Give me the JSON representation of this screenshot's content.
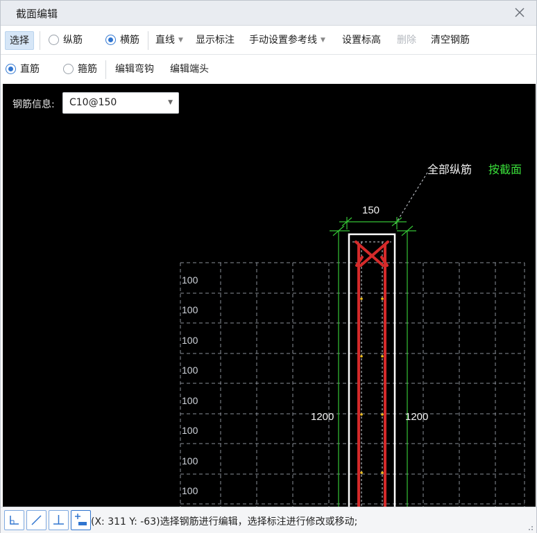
{
  "window": {
    "title": "截面编辑"
  },
  "toolbar1": {
    "select_label": "选择",
    "longitudinal_label": "纵筋",
    "transverse_label": "横筋",
    "line_label": "直线",
    "show_annotation_label": "显示标注",
    "manual_reference_label": "手动设置参考线",
    "set_elevation_label": "设置标高",
    "delete_label": "删除",
    "clear_rebar_label": "清空钢筋"
  },
  "toolbar2": {
    "straight_label": "直筋",
    "stirrup_label": "箍筋",
    "edit_hook_label": "编辑弯钩",
    "edit_end_label": "编辑端头"
  },
  "radios": {
    "rebar_type_selected": "横筋",
    "shape_selected": "直筋"
  },
  "rebar_info": {
    "label": "钢筋信息:",
    "value": "C10@150"
  },
  "drawing": {
    "all_longitudinal_label": "全部纵筋",
    "by_section_label": "按截面",
    "width_dim": "150",
    "left_height_dim": "1200",
    "right_height_dim": "1200",
    "grid_labels": [
      "100",
      "100",
      "100",
      "100",
      "100",
      "100",
      "100",
      "100"
    ]
  },
  "status": {
    "text": "(X: 311 Y: -63)选择钢筋进行编辑，选择标注进行修改或移动;"
  },
  "colors": {
    "canvas_bg": "#000000",
    "rebar_red": "#d42a2a",
    "dim_green": "#35c435",
    "by_section_green": "#3adf3a",
    "section_outline": "#ffffff",
    "grid_dash": "#8a8f99",
    "node_yellow": "#f0c020",
    "accent_blue": "#2f74cf"
  },
  "icons": {
    "close": "close-icon",
    "snap_corner": "corner-snap-icon",
    "snap_line": "oblique-snap-icon",
    "snap_perpendicular": "perpendicular-snap-icon",
    "snap_add": "add-point-icon"
  }
}
